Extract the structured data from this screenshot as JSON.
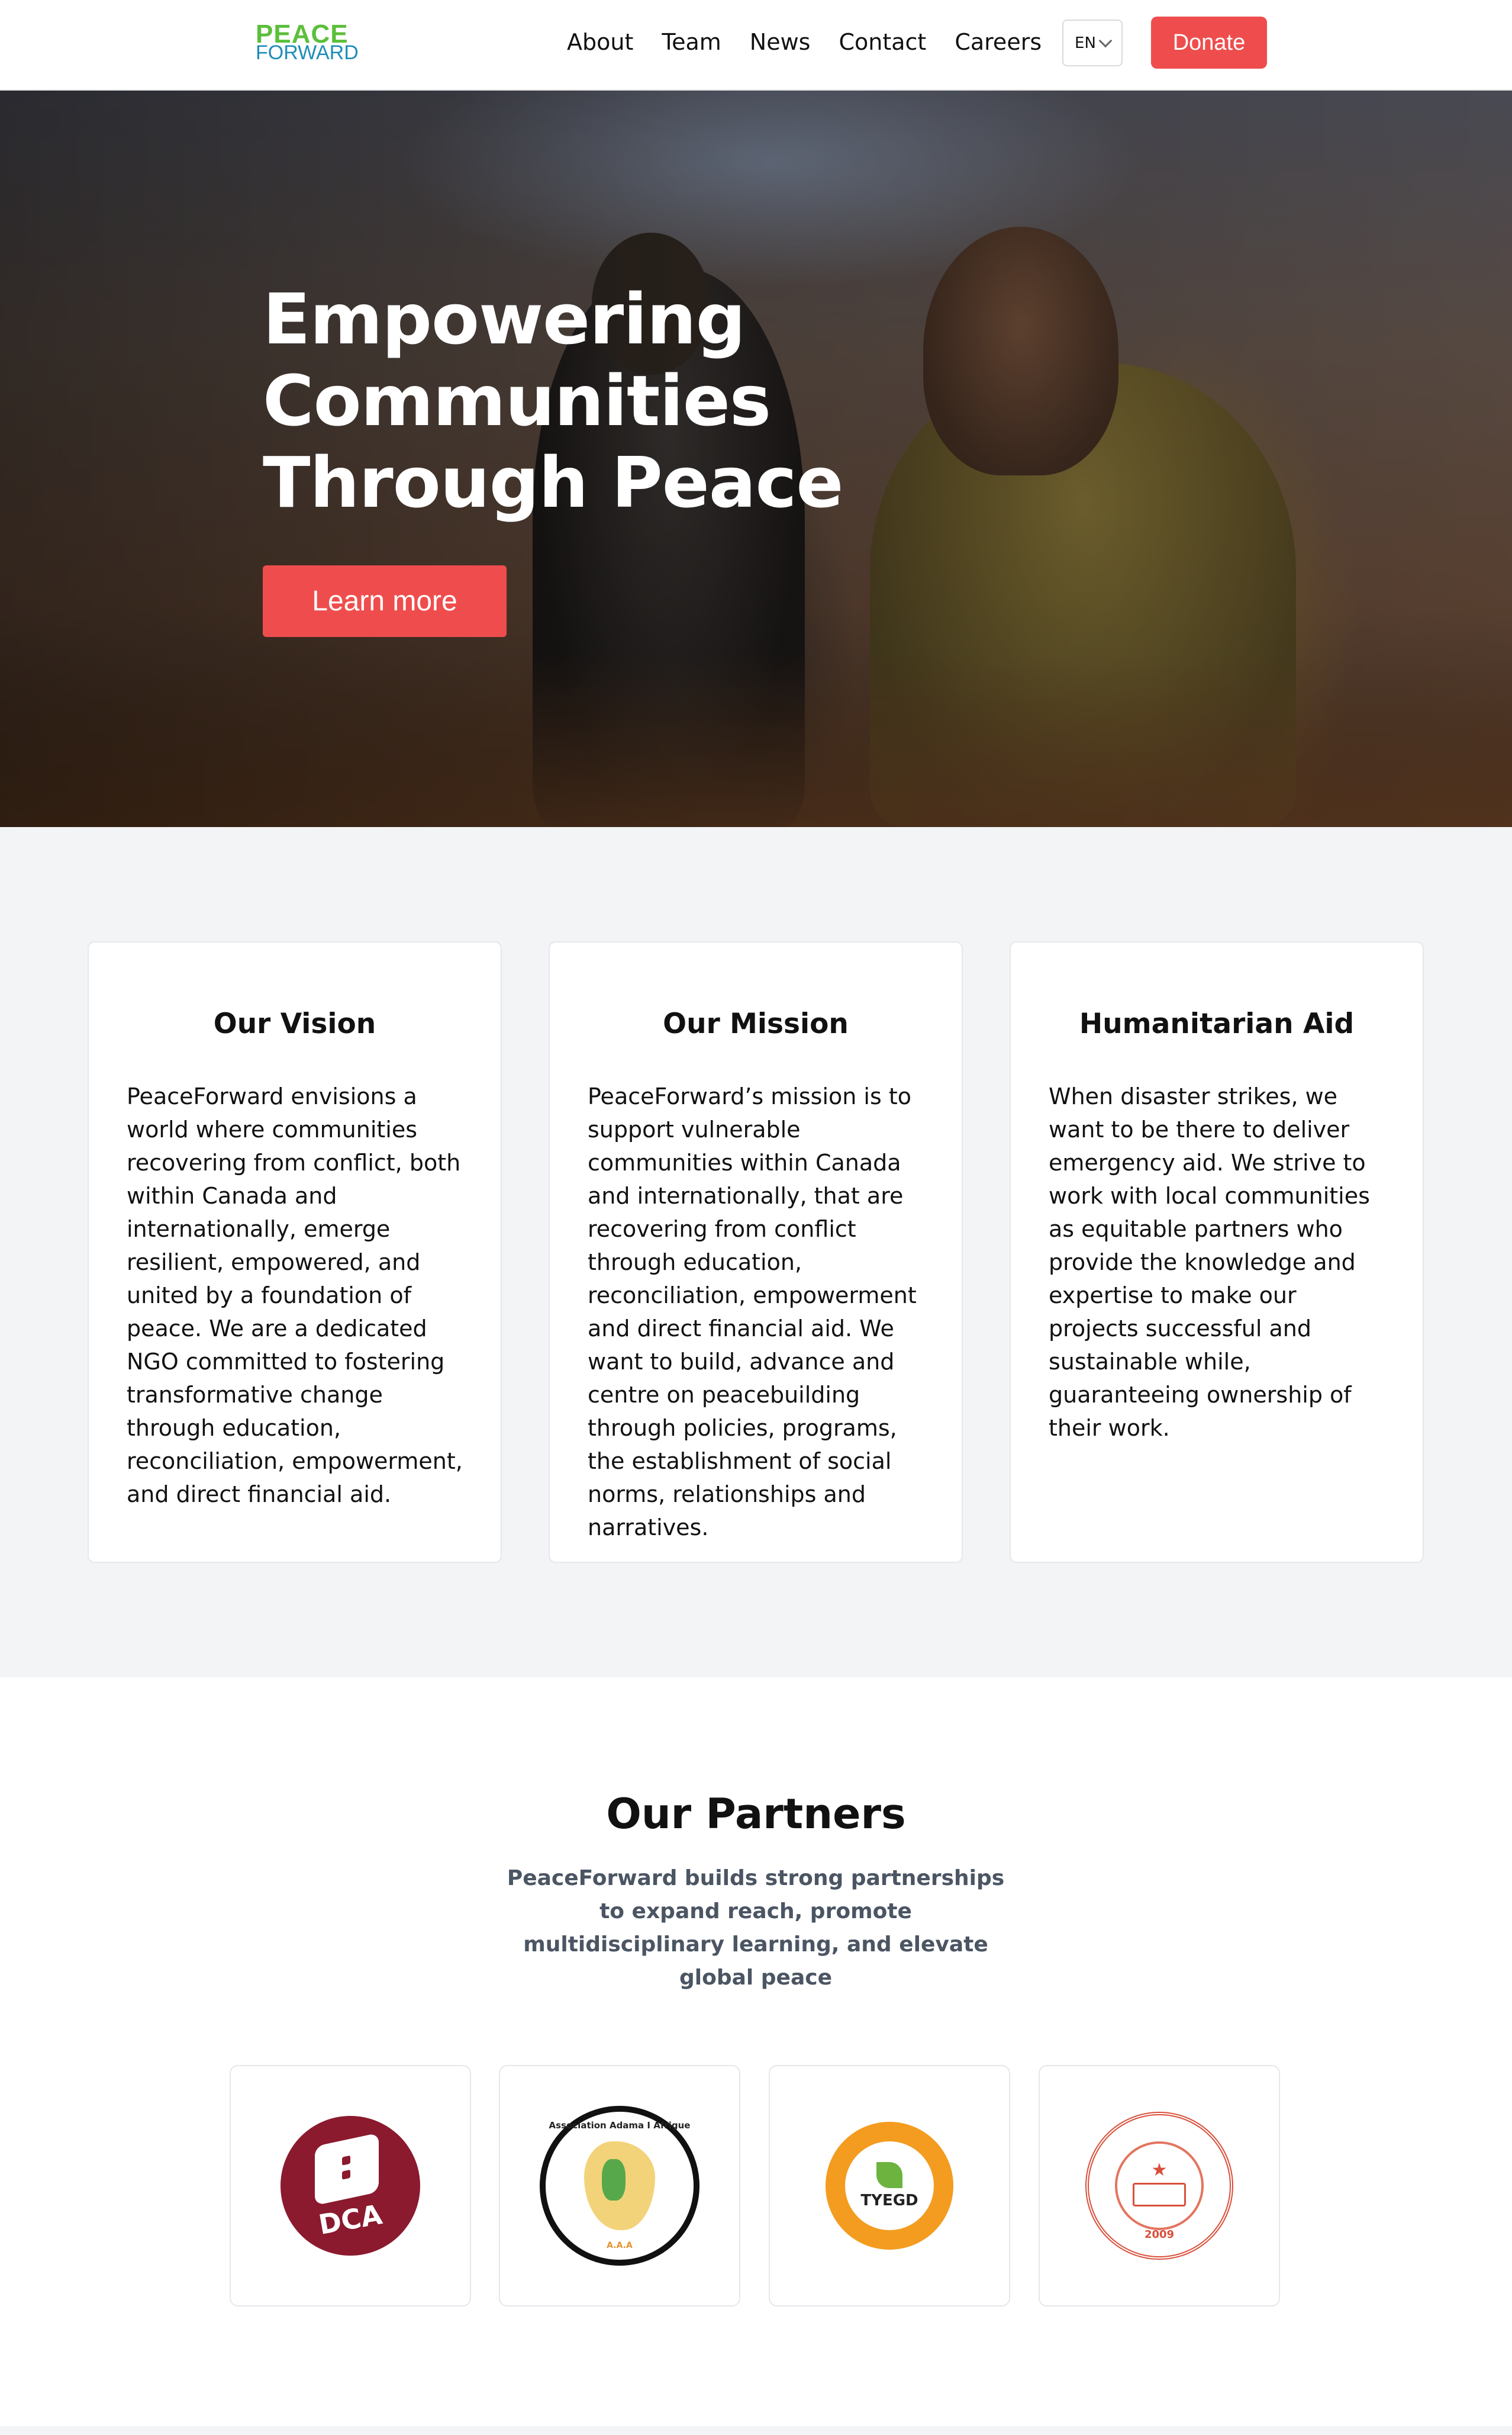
{
  "nav": {
    "logo_top": "PEACE",
    "logo_bottom": "FORWARD",
    "links": [
      "About",
      "Team",
      "News",
      "Contact",
      "Careers"
    ],
    "language": "EN",
    "donate_label": "Donate"
  },
  "hero": {
    "title": "Empowering Communities Through Peace",
    "cta_label": "Learn more"
  },
  "values": [
    {
      "title": "Our Vision",
      "text": "PeaceForward envisions a world where communities recovering from conflict, both within Canada and internationally, emerge resilient, empowered, and united by a foundation of peace. We are a dedicated NGO committed to fostering transformative change through education, reconciliation, empowerment, and direct financial aid."
    },
    {
      "title": "Our Mission",
      "text": "PeaceForward’s mission is to support vulnerable communities within Canada and internationally, that are recovering from conflict through education, reconciliation, empowerment and direct financial aid. We want to build, advance and centre on peacebuilding through policies, programs, the establishment of social norms, relationships and narratives."
    },
    {
      "title": "Humanitarian Aid",
      "text": "When disaster strikes, we want to be there to deliver emergency aid. We strive to work with local communities as equitable partners who provide the knowledge and expertise to make our projects successful and sustainable while, guaranteeing ownership of their work."
    }
  ],
  "partners": {
    "title": "Our Partners",
    "subtitle": "PeaceForward builds strong partnerships to expand reach, promote multidisciplinary learning, and elevate global peace",
    "logos": [
      {
        "name": "dca-logo",
        "text": "DCA"
      },
      {
        "name": "aaa-logo",
        "ring_text": "Association Adama I Afrigue",
        "bottom_text": "A.A.A"
      },
      {
        "name": "tyegd-logo",
        "text": "TYEGD"
      },
      {
        "name": "absst-logo",
        "year": "2009"
      }
    ]
  },
  "colors": {
    "accent": "#ef4d4d",
    "logo_green": "#5bbf3a",
    "logo_blue": "#1f8db7",
    "section_bg": "#f3f4f6"
  }
}
